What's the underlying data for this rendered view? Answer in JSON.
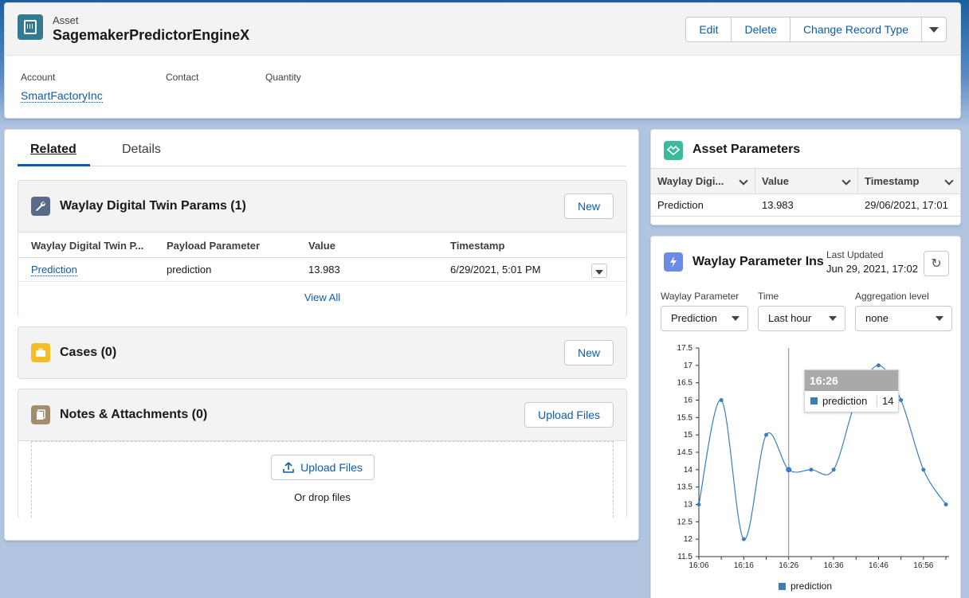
{
  "header": {
    "object_label": "Asset",
    "title": "SagemakerPredictorEngineX",
    "buttons": {
      "edit": "Edit",
      "delete": "Delete",
      "change_record_type": "Change Record Type"
    },
    "fields": [
      {
        "label": "Account",
        "value": "SmartFactoryInc"
      },
      {
        "label": "Contact",
        "value": ""
      },
      {
        "label": "Quantity",
        "value": ""
      }
    ]
  },
  "tabs": {
    "related": "Related",
    "details": "Details"
  },
  "digital_twin": {
    "title": "Waylay Digital Twin Params (1)",
    "new_label": "New",
    "columns": [
      "Waylay Digital Twin P...",
      "Payload Parameter",
      "Value",
      "Timestamp"
    ],
    "rows": [
      {
        "name": "Prediction",
        "payload": "prediction",
        "value": "13.983",
        "timestamp": "6/29/2021, 5:01 PM"
      }
    ],
    "view_all": "View All"
  },
  "cases": {
    "title": "Cases (0)",
    "new_label": "New"
  },
  "notes": {
    "title": "Notes & Attachments (0)",
    "upload_label": "Upload Files",
    "drop_upload_label": "Upload Files",
    "drop_text": "Or drop files"
  },
  "asset_params": {
    "title": "Asset Parameters",
    "columns": [
      "Waylay Digi...",
      "Value",
      "Timestamp"
    ],
    "rows": [
      {
        "name": "Prediction",
        "value": "13.983",
        "timestamp": "29/06/2021, 17:01"
      }
    ]
  },
  "insights": {
    "title": "Waylay Parameter Ins",
    "last_updated_label": "Last Updated",
    "last_updated_value": "Jun 29, 2021, 17:02",
    "filters": {
      "parameter": {
        "label": "Waylay Parameter",
        "value": "Prediction"
      },
      "time": {
        "label": "Time",
        "value": "Last hour"
      },
      "aggregation": {
        "label": "Aggregation level",
        "value": "none"
      }
    },
    "tooltip": {
      "time": "16:26",
      "series": "prediction",
      "value": "14"
    }
  },
  "chart_data": {
    "type": "line",
    "x": [
      "16:06",
      "16:11",
      "16:16",
      "16:21",
      "16:26",
      "16:31",
      "16:36",
      "16:41",
      "16:46",
      "16:51",
      "16:56",
      "17:01"
    ],
    "x_ticks": [
      "16:06",
      "16:16",
      "16:26",
      "16:36",
      "16:46",
      "16:56"
    ],
    "y_ticks": [
      "11.5",
      "12",
      "12.5",
      "13",
      "13.5",
      "14",
      "14.5",
      "15",
      "15.5",
      "16",
      "16.5",
      "17",
      "17.5"
    ],
    "ylim": [
      11.5,
      17.5
    ],
    "series": [
      {
        "name": "prediction",
        "values": [
          13,
          16,
          12,
          15,
          14,
          14,
          14,
          16,
          17,
          16,
          14,
          13
        ]
      }
    ],
    "legend": "bottom",
    "highlight_index": 4,
    "colors": {
      "line": "#3a7ebf"
    }
  }
}
